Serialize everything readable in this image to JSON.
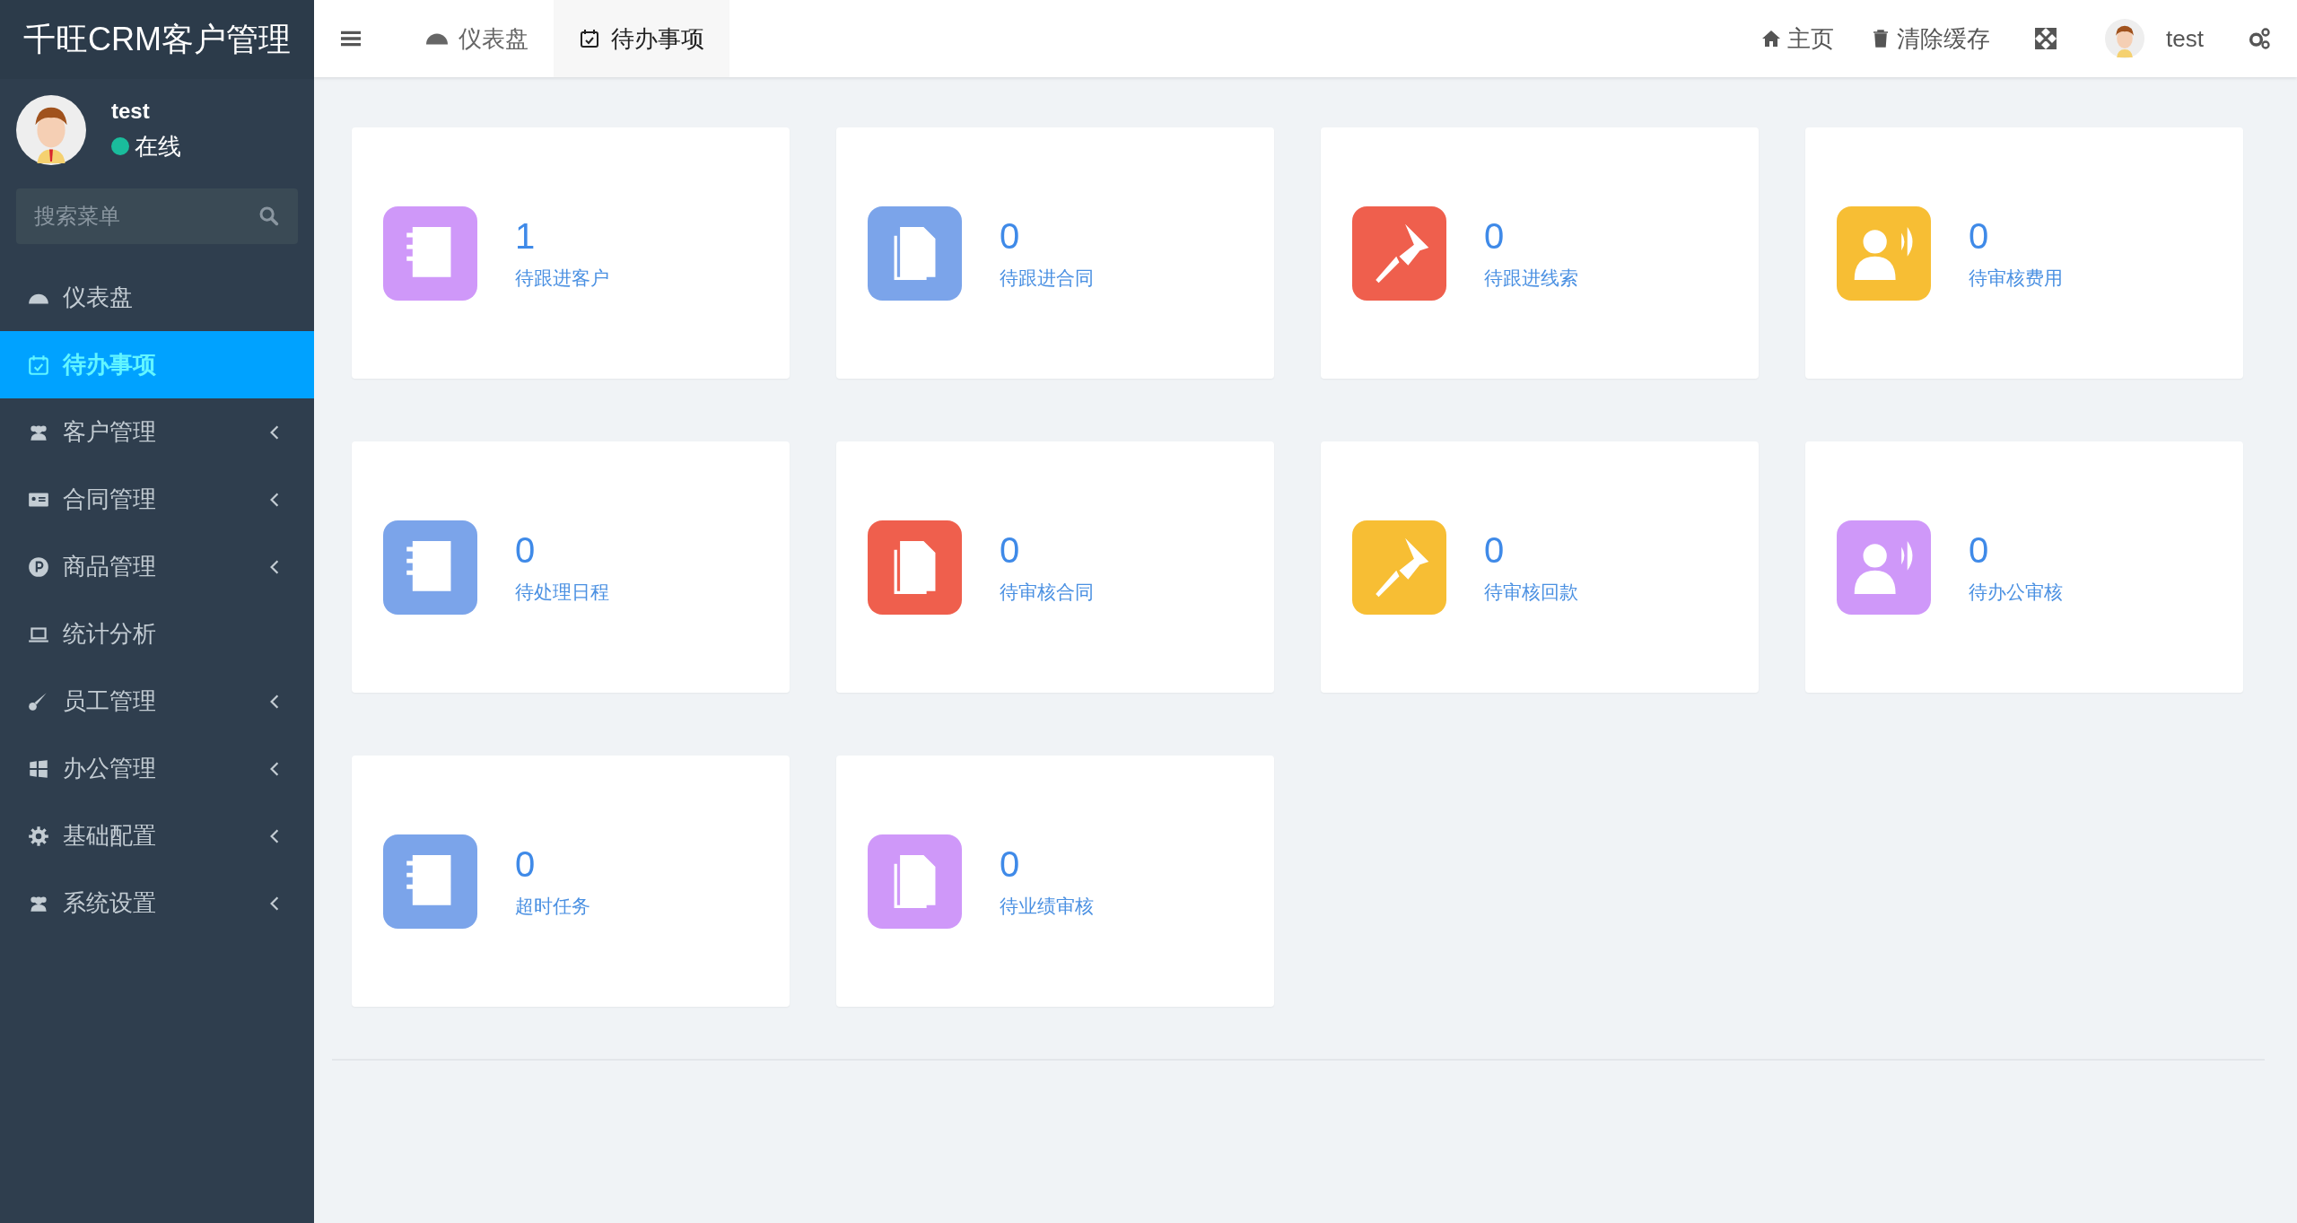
{
  "sidebar": {
    "logo": "千旺CRM客户管理",
    "user": {
      "name": "test",
      "status": "在线",
      "online": true
    },
    "search": {
      "placeholder": "搜索菜单"
    },
    "items": [
      {
        "label": "仪表盘",
        "selected": false,
        "has_submenu": false
      },
      {
        "label": "待办事项",
        "selected": true,
        "has_submenu": false
      },
      {
        "label": "客户管理",
        "selected": false,
        "has_submenu": true
      },
      {
        "label": "合同管理",
        "selected": false,
        "has_submenu": true
      },
      {
        "label": "商品管理",
        "selected": false,
        "has_submenu": true
      },
      {
        "label": "统计分析",
        "selected": false,
        "has_submenu": false
      },
      {
        "label": "员工管理",
        "selected": false,
        "has_submenu": true
      },
      {
        "label": "办公管理",
        "selected": false,
        "has_submenu": true
      },
      {
        "label": "基础配置",
        "selected": false,
        "has_submenu": true
      },
      {
        "label": "系统设置",
        "selected": false,
        "has_submenu": true
      }
    ]
  },
  "topbar": {
    "tabs": [
      {
        "label": "仪表盘",
        "selected": false
      },
      {
        "label": "待办事项",
        "selected": true
      }
    ],
    "links": [
      {
        "label": "主页"
      },
      {
        "label": "清除缓存"
      }
    ],
    "user": "test"
  },
  "cards": [
    {
      "count": "1",
      "label": "待跟进客户",
      "color": "#cf98f9"
    },
    {
      "count": "0",
      "label": "待跟进合同",
      "color": "#7ba4ea"
    },
    {
      "count": "0",
      "label": "待跟进线索",
      "color": "#ef5f4d"
    },
    {
      "count": "0",
      "label": "待审核费用",
      "color": "#f7be34"
    },
    {
      "count": "0",
      "label": "待处理日程",
      "color": "#7ba4ea"
    },
    {
      "count": "0",
      "label": "待审核合同",
      "color": "#ef5f4d"
    },
    {
      "count": "0",
      "label": "待审核回款",
      "color": "#f7be34"
    },
    {
      "count": "0",
      "label": "待办公审核",
      "color": "#cf98f9"
    },
    {
      "count": "0",
      "label": "超时任务",
      "color": "#7ba4ea"
    },
    {
      "count": "0",
      "label": "待业绩审核",
      "color": "#cf98f9"
    }
  ]
}
